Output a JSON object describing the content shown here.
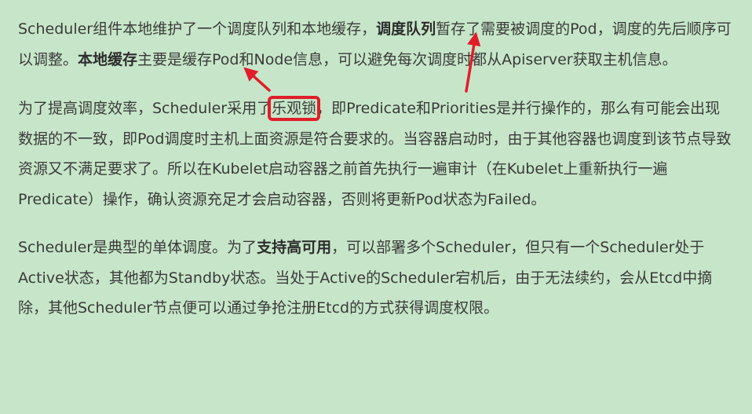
{
  "article": {
    "paragraphs": [
      {
        "segments": [
          {
            "text": "Scheduler组件本地维护了一个调度队列和本地缓存，",
            "bold": false
          },
          {
            "text": "调度队列",
            "bold": true
          },
          {
            "text": "暂存了需要被调度的Pod，调度的先后顺序可以调整。",
            "bold": false
          },
          {
            "text": "本地缓存",
            "bold": true
          },
          {
            "text": "主要是缓存Pod和Node信息，可以避免每次调度时都从Apiserver获取主机信息。",
            "bold": false
          }
        ]
      },
      {
        "segments": [
          {
            "text": "为了提高调度效率，Scheduler采用了",
            "bold": false
          },
          {
            "text": "乐观锁",
            "bold": false,
            "boxed": true
          },
          {
            "text": "，即Predicate和Priorities是并行操作的，那么有可能会出现数据的不一致，即Pod调度时主机上面资源是符合要求的。当容器启动时，由于其他容器也调度到该节点导致资源又不满足要求了。所以在Kubelet启动容器之前首先执行一遍审计（在Kubelet上重新执行一遍Predicate）操作，确认资源充足才会启动容器，否则将更新Pod状态为Failed。",
            "bold": false
          }
        ]
      },
      {
        "segments": [
          {
            "text": "Scheduler是典型的单体调度。为了",
            "bold": false
          },
          {
            "text": "支持高可用",
            "bold": true
          },
          {
            "text": "，可以部署多个Scheduler，但只有一个Scheduler处于Active状态，其他都为Standby状态。当处于Active的Scheduler宕机后，由于无法续约，会从Etcd中摘除，其他Scheduler节点便可以通过争抢注册Etcd的方式获得调度权限。",
            "bold": false
          }
        ]
      }
    ]
  },
  "annotation_colors": {
    "arrow": "#e11d2a",
    "highlight_box": "#e11d2a"
  }
}
